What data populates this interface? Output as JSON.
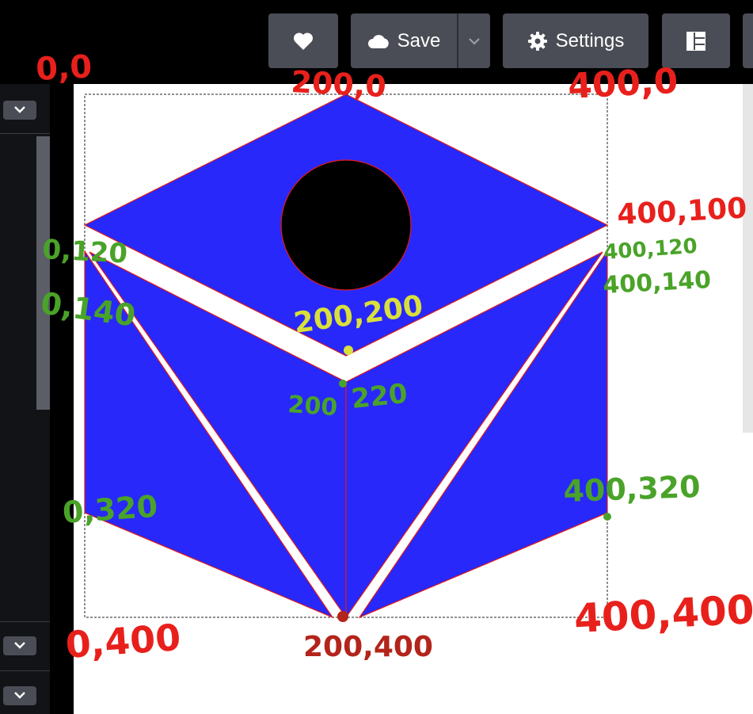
{
  "toolbar": {
    "favorite_icon": "heart-icon",
    "save_label": "Save",
    "save_icon": "cloud-icon",
    "save_menu_icon": "chevron-down-icon",
    "settings_label": "Settings",
    "settings_icon": "gear-icon",
    "layout_icon": "layout-panels-icon"
  },
  "sidebar": {
    "collapse_icon": "chevron-down-icon"
  },
  "colors": {
    "fill": "#2828fa",
    "stroke": "#e11a1a",
    "hole": "#000000",
    "annotation_red": "#e8201c",
    "annotation_green": "#4aa329",
    "annotation_yellow": "#d9e03a",
    "annotation_darkred": "#b3241a"
  },
  "annotations": {
    "corner_top_left": "0,0",
    "corner_top_mid": "200,0",
    "corner_top_right": "400,0",
    "pt_right_100": "400,100",
    "pt_left_120": "0,120",
    "pt_left_140": "0,140",
    "pt_right_120": "400,120",
    "pt_right_140": "400,140",
    "pt_center_200": "200,200",
    "pt_center_220_a": "200",
    "pt_center_220_b": "220",
    "pt_left_320": "0,320",
    "pt_right_320": "400,320",
    "pt_bottom_left": "0,400",
    "pt_bottom_mid": "200,400",
    "pt_bottom_right": "400,400"
  }
}
